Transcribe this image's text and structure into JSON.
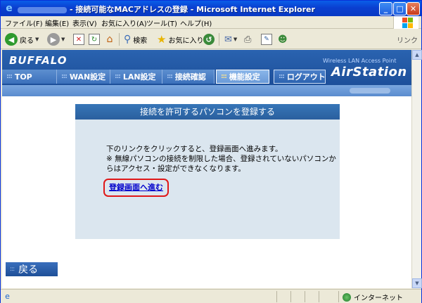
{
  "window": {
    "title": "- 接続可能なMACアドレスの登録 - Microsoft Internet Explorer"
  },
  "menu": [
    "ファイル(F)",
    "編集(E)",
    "表示(V)",
    "お気に入り(A)",
    "ツール(T)",
    "ヘルプ(H)"
  ],
  "toolbar": {
    "back_label": "戻る",
    "search_label": "検索",
    "favorites_label": "お気に入り",
    "links_label": "リンク"
  },
  "header": {
    "brand": "BUFFALO",
    "product_sub": "Wireless LAN Access Point",
    "product": "AirStation",
    "tabs": [
      "TOP",
      "WAN設定",
      "LAN設定",
      "接続確認",
      "機能設定",
      "ログアウト"
    ],
    "active_tab": "機能設定"
  },
  "panel": {
    "title": "接続を許可するパソコンを登録する",
    "text": "下のリンクをクリックすると、登録画面へ進みます。\n※ 無線パソコンの接続を制限した場合、登録されていないパソコンからはアクセス・設定ができなくなります。",
    "link": "登録画面へ進む"
  },
  "back_button": "戻る",
  "status": {
    "zone": "インターネット"
  },
  "colors": {
    "header_blue": "#1d4f9a",
    "highlight_red": "#e01818",
    "panel_bg": "#dbe6ef"
  }
}
